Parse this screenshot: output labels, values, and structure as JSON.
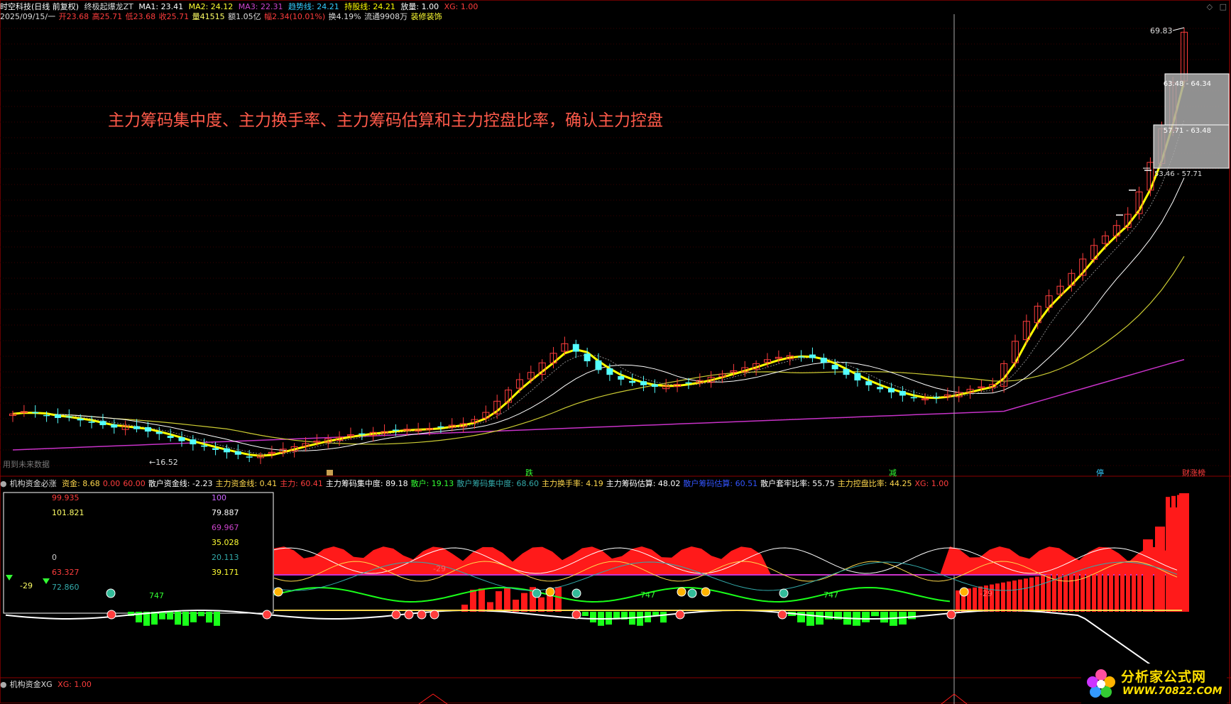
{
  "colors": {
    "background": "#000000",
    "up": "#ff3d3d",
    "down": "#54ffff",
    "ma1": "#ffffff",
    "ma2": "#ffff33",
    "ma3": "#cc33cc",
    "trend": "#33ccff",
    "hold": "#ffff00",
    "annotation": "#ff5a4a",
    "grid": "#3a0000"
  },
  "header": {
    "stock": "时空科技(日线 前复权)",
    "indicator_name": "终极起爆龙ZT",
    "ma1": "MA1: 23.41",
    "ma2": "MA2: 24.12",
    "ma3": "MA3: 22.31",
    "trend": "趋势线: 24.21",
    "hold": "持股线: 24.21",
    "volume_flag": "放量: 1.00",
    "xg": "XG: 1.00"
  },
  "info_line": {
    "date": "2025/09/15/一",
    "open": "开23.68",
    "high": "高25.71",
    "low": "低23.68",
    "close": "收25.71",
    "volume": "量41515",
    "amount": "额1.05亿",
    "change": "幅2.34(10.01%)",
    "turnover": "换4.19%",
    "float": "流通9908万",
    "industry": "装修装饰"
  },
  "main_chart": {
    "type": "candlestick",
    "price_max_label": "69.83",
    "price_min_label": "←16.52",
    "left_note": "用到未来数据",
    "boxes": [
      {
        "label": "63.48 - 64.34",
        "low": 63.48,
        "high": 64.34
      },
      {
        "label": "57.71 - 63.48",
        "low": 57.71,
        "high": 63.48
      },
      {
        "label": "53.46 - 57.71",
        "low": 53.46,
        "high": 57.71
      }
    ],
    "markers": [
      {
        "label": "跌"
      },
      {
        "label": "减"
      },
      {
        "label": "停"
      },
      {
        "label": "财涨榜"
      }
    ],
    "annotation": "主力筹码集中度、主力换手率、主力筹码估算和主力控盘比率，确认主力控盘"
  },
  "chart_data": {
    "type": "candlestick",
    "title": "",
    "price_range": [
      16.52,
      69.83
    ],
    "ohlc_close_series": [
      22.0,
      22.3,
      22.1,
      21.8,
      21.5,
      21.6,
      21.2,
      20.9,
      20.6,
      20.3,
      20.5,
      20.1,
      19.8,
      19.5,
      19.0,
      18.6,
      18.2,
      17.9,
      17.5,
      17.2,
      16.9,
      16.6,
      16.8,
      17.2,
      17.6,
      17.9,
      18.3,
      18.6,
      18.9,
      19.1,
      19.4,
      19.5,
      19.7,
      19.8,
      20.0,
      20.1,
      20.0,
      20.2,
      20.4,
      20.6,
      20.8,
      21.3,
      22.2,
      23.6,
      25.0,
      26.3,
      27.2,
      28.4,
      29.6,
      30.8,
      29.8,
      28.6,
      27.5,
      26.9,
      26.3,
      25.9,
      25.6,
      25.4,
      25.5,
      25.7,
      25.9,
      26.2,
      26.6,
      27.0,
      27.4,
      27.8,
      28.3,
      28.8,
      29.1,
      29.3,
      29.2,
      29.0,
      28.4,
      27.6,
      26.9,
      26.2,
      25.6,
      25.1,
      24.7,
      24.3,
      24.0,
      23.9,
      24.1,
      24.4,
      24.7,
      25.1,
      25.4,
      25.7,
      28.3,
      31.1,
      33.6,
      35.5,
      36.8,
      38.0,
      39.6,
      41.4,
      43.1,
      44.3,
      45.6,
      47.0,
      49.8,
      53.5,
      57.7,
      63.5,
      69.8
    ],
    "series": [
      {
        "name": "MA1",
        "value": 23.41
      },
      {
        "name": "MA2",
        "value": 24.12
      },
      {
        "name": "MA3",
        "value": 22.31
      },
      {
        "name": "趋势线",
        "value": 24.21
      },
      {
        "name": "持股线",
        "value": 24.21
      }
    ]
  },
  "sub_panel_1": {
    "name": "机构资金必涨",
    "items": [
      {
        "label": "资金: 8.68",
        "color": "#ffd84d"
      },
      {
        "label": "0.00",
        "color": "#ff3d3d"
      },
      {
        "label": "60.00",
        "color": "#ff3d3d"
      },
      {
        "label": "散户资金线: -2.23",
        "color": "#ffffff"
      },
      {
        "label": "主力资金线: 0.41",
        "color": "#ffd84d"
      },
      {
        "label": "主力: 60.41",
        "color": "#ff3d3d"
      },
      {
        "label": "主力筹码集中度: 89.18",
        "color": "#ffffff"
      },
      {
        "label": "散户: 19.13",
        "color": "#33ff33"
      },
      {
        "label": "散户筹码集中度: 68.60",
        "color": "#33aaaa"
      },
      {
        "label": "主力换手率: 4.19",
        "color": "#ffd84d"
      },
      {
        "label": "主力筹码估算: 48.02",
        "color": "#ffffff"
      },
      {
        "label": "散户筹码估算: 60.51",
        "color": "#3355ff"
      },
      {
        "label": "散户套牢比率: 55.75",
        "color": "#ffffff"
      },
      {
        "label": "主力控盘比率: 44.25",
        "color": "#ffd84d"
      },
      {
        "label": "XG: 1.00",
        "color": "#ff3d3d"
      }
    ],
    "legend_box": {
      "left_col": [
        {
          "value": "99.935",
          "color": "#ff3d3d"
        },
        {
          "value": "101.821",
          "color": "#ffff66"
        },
        {
          "value": "",
          "color": "#ffffff"
        },
        {
          "value": "",
          "color": "#ffffff"
        },
        {
          "value": "0",
          "color": "#cccccc"
        },
        {
          "value": "63.327",
          "color": "#ff3d3d"
        },
        {
          "value": "72.860",
          "color": "#33aaaa"
        }
      ],
      "right_col": [
        {
          "value": "100",
          "color": "#cc66ff"
        },
        {
          "value": "79.887",
          "color": "#ffffff"
        },
        {
          "value": "69.967",
          "color": "#cc44cc"
        },
        {
          "value": "35.028",
          "color": "#ffff33"
        },
        {
          "value": "20.113",
          "color": "#33aaaa"
        },
        {
          "value": "39.171",
          "color": "#ffff33"
        }
      ],
      "neg_label": "-29",
      "vol_label": "747"
    },
    "inline_labels": [
      "747",
      "747",
      "-29",
      "-29"
    ]
  },
  "sub_panel_2": {
    "name": "机构资金XG",
    "xg": "XG: 1.00"
  },
  "logo": {
    "name": "分析家公式网",
    "url": "WWW.70822.COM"
  }
}
